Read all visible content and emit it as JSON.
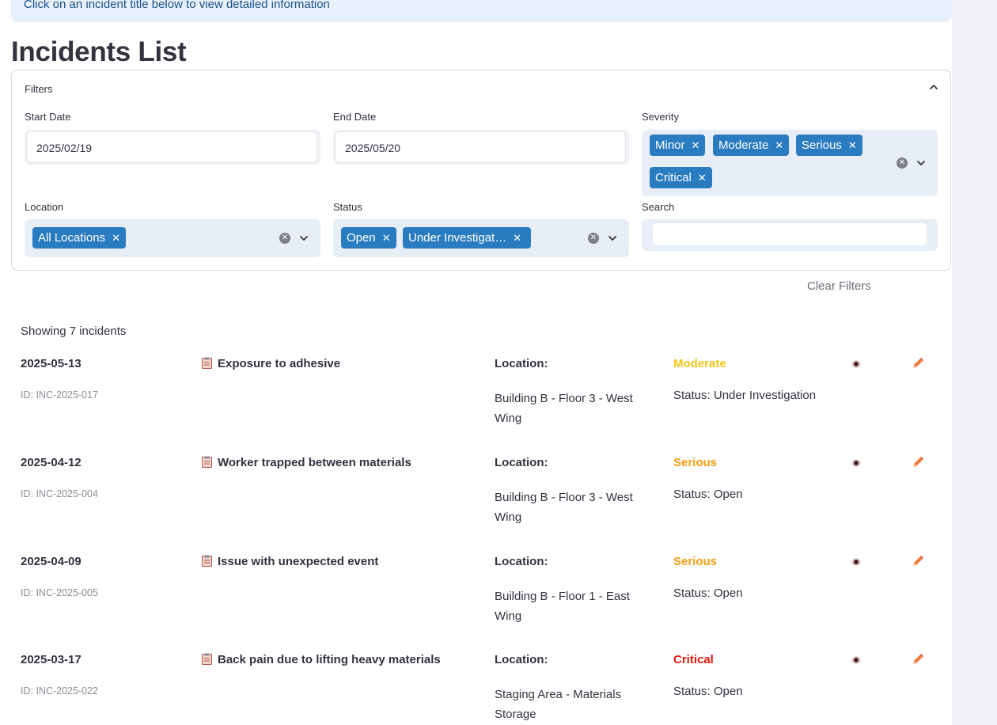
{
  "banner": {
    "text": "Click on an incident title below to view detailed information"
  },
  "page_title": "Incidents List",
  "filters": {
    "title": "Filters",
    "start_date": {
      "label": "Start Date",
      "value": "2025/02/19"
    },
    "end_date": {
      "label": "End Date",
      "value": "2025/05/20"
    },
    "severity": {
      "label": "Severity",
      "tags": [
        "Minor",
        "Moderate",
        "Serious",
        "Critical"
      ]
    },
    "location": {
      "label": "Location",
      "tags": [
        "All Locations"
      ]
    },
    "status": {
      "label": "Status",
      "tags": [
        "Open",
        "Under Investigat…"
      ]
    },
    "search": {
      "label": "Search",
      "value": ""
    },
    "clear_label": "Clear Filters"
  },
  "results": {
    "count_text": "Showing 7 incidents",
    "location_label": "Location:",
    "incidents": [
      {
        "date": "2025-05-13",
        "id": "ID: INC-2025-017",
        "title": "Exposure to adhesive",
        "location": "Building B - Floor 3 - West Wing",
        "severity": "Moderate",
        "status": "Status: Under Investigation"
      },
      {
        "date": "2025-04-12",
        "id": "ID: INC-2025-004",
        "title": "Worker trapped between materials",
        "location": "Building B - Floor 3 - West Wing",
        "severity": "Serious",
        "status": "Status: Open"
      },
      {
        "date": "2025-04-09",
        "id": "ID: INC-2025-005",
        "title": "Issue with unexpected event",
        "location": "Building B - Floor 1 - East Wing",
        "severity": "Serious",
        "status": "Status: Open"
      },
      {
        "date": "2025-03-17",
        "id": "ID: INC-2025-022",
        "title": "Back pain due to lifting heavy materials",
        "location": "Staging Area - Materials Storage",
        "severity": "Critical",
        "status": "Status: Open"
      }
    ]
  },
  "colors": {
    "tag_bg": "#2a7cc1",
    "severity_moderate": "#f5c518",
    "severity_serious": "#f39c12",
    "severity_critical": "#e8160c"
  },
  "icons": {
    "row_title": "clipboard-icon",
    "view": "eye-icon",
    "edit": "pencil-icon"
  }
}
